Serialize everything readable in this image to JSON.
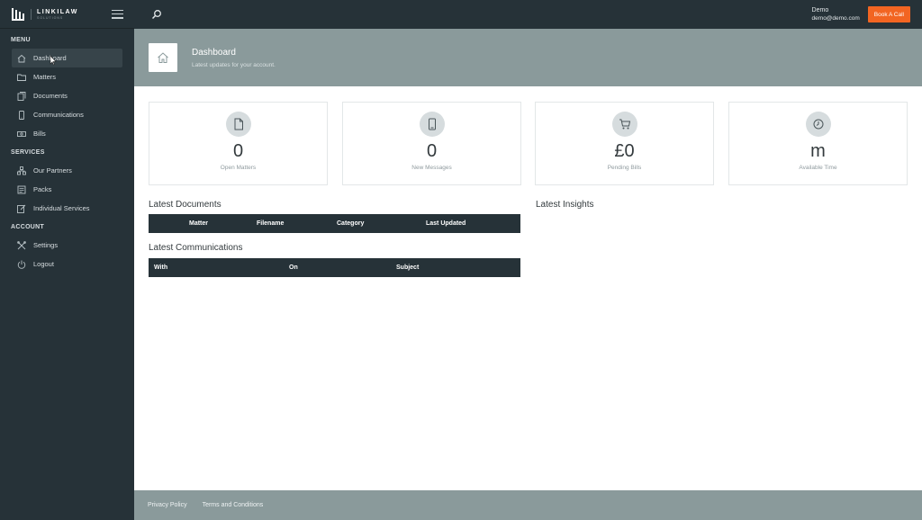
{
  "app": {
    "logo_title": "LINKILAW",
    "logo_subtitle": "SOLUTIONS",
    "accent_color": "#f26522",
    "sidebar_color": "#263238"
  },
  "sidebar": {
    "sections": [
      {
        "label": "MENU",
        "items": [
          {
            "label": "Dashboard",
            "icon": "home-icon",
            "active": true
          },
          {
            "label": "Matters",
            "icon": "folder-icon"
          },
          {
            "label": "Documents",
            "icon": "documents-icon"
          },
          {
            "label": "Communications",
            "icon": "phone-icon"
          },
          {
            "label": "Bills",
            "icon": "money-icon"
          }
        ]
      },
      {
        "label": "SERVICES",
        "items": [
          {
            "label": "Our Partners",
            "icon": "partners-icon"
          },
          {
            "label": "Packs",
            "icon": "packs-icon"
          },
          {
            "label": "Individual Services",
            "icon": "edit-icon"
          }
        ]
      },
      {
        "label": "ACCOUNT",
        "items": [
          {
            "label": "Settings",
            "icon": "tools-icon"
          },
          {
            "label": "Logout",
            "icon": "power-icon"
          }
        ]
      }
    ]
  },
  "topbar": {
    "user_name": "Demo",
    "user_email": "demo@demo.com",
    "book_call_label": "Book A Call"
  },
  "page_header": {
    "title": "Dashboard",
    "subtitle": "Latest updates for your account."
  },
  "stats": [
    {
      "value": "0",
      "label": "Open Matters",
      "icon": "file-icon"
    },
    {
      "value": "0",
      "label": "New Messages",
      "icon": "mobile-icon"
    },
    {
      "value": "£0",
      "label": "Pending Bills",
      "icon": "cart-icon"
    },
    {
      "value": "m",
      "label": "Available Time",
      "icon": "clock-icon"
    }
  ],
  "latest_documents": {
    "title": "Latest Documents",
    "columns": [
      "Matter",
      "Filename",
      "Category",
      "Last Updated"
    ]
  },
  "latest_communications": {
    "title": "Latest Communications",
    "columns": [
      "With",
      "On",
      "Subject"
    ]
  },
  "latest_insights": {
    "title": "Latest Insights"
  },
  "footer": {
    "privacy_label": "Privacy Policy",
    "terms_label": "Terms and Conditions"
  }
}
